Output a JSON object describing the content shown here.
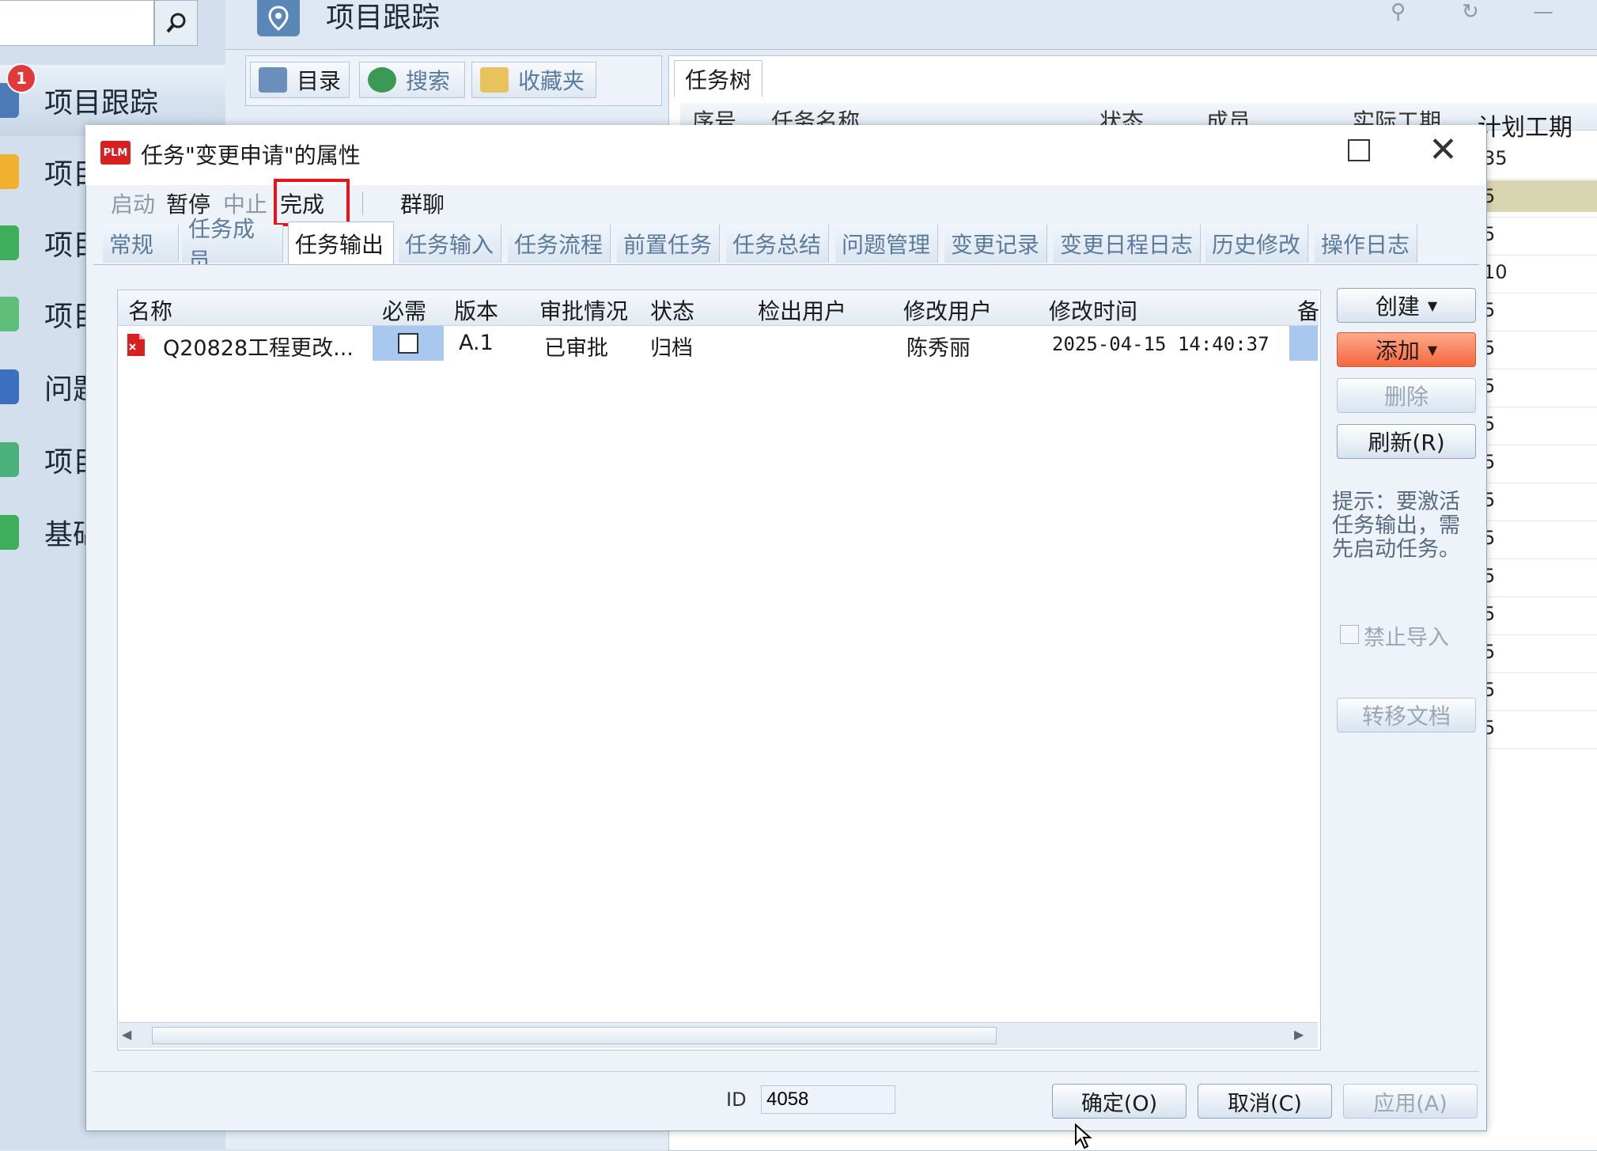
{
  "app": {
    "title": "项目跟踪",
    "badge_count": "1",
    "nav_items": [
      {
        "label": "项目跟踪",
        "color": "#4c7ab5"
      },
      {
        "label": "项目",
        "color": "#f0b030"
      },
      {
        "label": "项目",
        "color": "#3fae5a"
      },
      {
        "label": "项目",
        "color": "#5fbf7a"
      },
      {
        "label": "问题",
        "color": "#3b6fc0"
      },
      {
        "label": "项目",
        "color": "#4cb07a"
      },
      {
        "label": "基础",
        "color": "#3fae5a"
      }
    ],
    "left_tabs": [
      {
        "label": "目录",
        "icon": "computer-icon"
      },
      {
        "label": "搜索",
        "icon": "search-globe-icon"
      },
      {
        "label": "收藏夹",
        "icon": "folder-icon"
      }
    ],
    "tree_tab": "任务树",
    "tree_header": {
      "seq": "序号",
      "name": "任务名称",
      "status": "状态",
      "members": "成员",
      "actual": "实际工期",
      "planned": "计划工期"
    },
    "tree_planned_values": [
      "35",
      "5",
      "5",
      "10",
      "5",
      "5",
      "5",
      "5",
      "5",
      "5",
      "5",
      "5",
      "5",
      "5",
      "5",
      "5"
    ]
  },
  "dialog": {
    "logo": "PLM",
    "title": "任务\"变更申请\"的属性",
    "actions": [
      {
        "label": "启动",
        "enabled": false
      },
      {
        "label": "暂停",
        "enabled": true
      },
      {
        "label": "中止",
        "enabled": false
      },
      {
        "label": "完成",
        "enabled": true,
        "highlighted": true
      },
      {
        "label": "群聊",
        "enabled": true
      }
    ],
    "tabs": [
      "常规",
      "任务成员",
      "任务输出",
      "任务输入",
      "任务流程",
      "前置任务",
      "任务总结",
      "问题管理",
      "变更记录",
      "变更日程日志",
      "历史修改",
      "操作日志"
    ],
    "active_tab": "任务输出",
    "table": {
      "columns": [
        "名称",
        "必需",
        "版本",
        "审批情况",
        "状态",
        "检出用户",
        "修改用户",
        "修改时间",
        "备"
      ],
      "rows": [
        {
          "name": "Q20828工程更改...",
          "required": false,
          "version": "A.1",
          "approval": "已审批",
          "status": "归档",
          "checkout_user": "",
          "modify_user": "陈秀丽",
          "modify_time": "2025-04-15 14:40:37"
        }
      ]
    },
    "side_buttons": [
      {
        "label": "创建",
        "dropdown": true,
        "style": "normal",
        "enabled": true
      },
      {
        "label": "添加",
        "dropdown": true,
        "style": "orange",
        "enabled": true
      },
      {
        "label": "删除",
        "dropdown": false,
        "style": "normal",
        "enabled": false
      },
      {
        "label": "刷新(R)",
        "dropdown": false,
        "style": "normal",
        "enabled": true
      }
    ],
    "hint": "提示：要激活任务输出，需先启动任务。",
    "forbid_import_label": "禁止导入",
    "transfer_doc_label": "转移文档",
    "id_label": "ID",
    "id_value": "4058",
    "ok_label": "确定(O)",
    "cancel_label": "取消(C)",
    "apply_label": "应用(A)"
  }
}
